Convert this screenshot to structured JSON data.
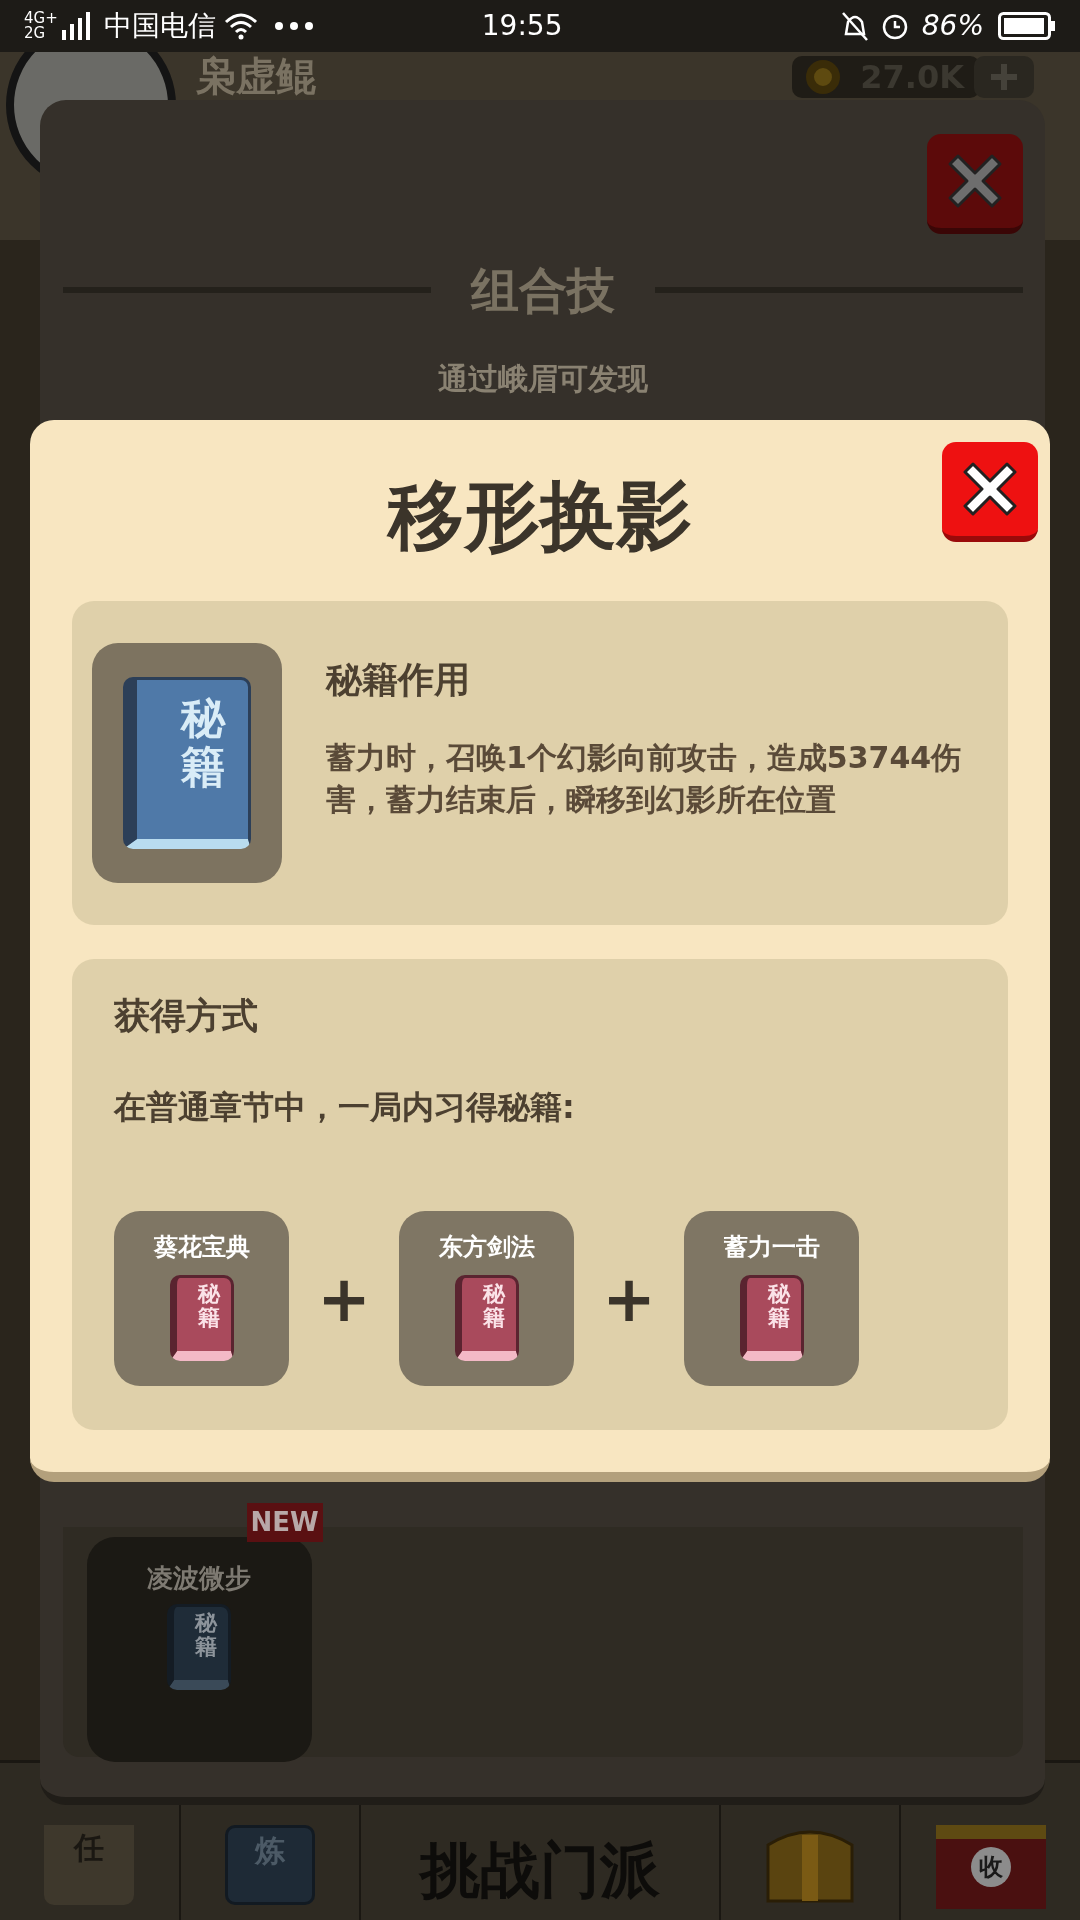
{
  "status_bar": {
    "network_top": "4G+",
    "network_bottom": "2G",
    "carrier": "中国电信",
    "time": "19:55",
    "battery": "86%"
  },
  "background": {
    "player_name": "枭虚鲲",
    "coins": "27.0K",
    "panel": {
      "section_title": "组合技",
      "hint": "通过峨眉可发现",
      "skill": {
        "name": "凌波微步",
        "badge": "NEW",
        "book_label": "秘籍"
      }
    },
    "nav": [
      {
        "kind": "scroll",
        "label": "任"
      },
      {
        "kind": "book",
        "label": "炼"
      },
      {
        "kind": "text",
        "label": "挑战门派"
      },
      {
        "kind": "chest"
      },
      {
        "kind": "shop",
        "label": "收"
      }
    ]
  },
  "dialog": {
    "title": "移形换影",
    "effect": {
      "book_label": "秘籍",
      "heading": "秘籍作用",
      "description": "蓄力时，召唤1个幻影向前攻击，造成53744伤害，蓄力结束后，瞬移到幻影所在位置"
    },
    "obtain": {
      "heading": "获得方式",
      "instruction": "在普通章节中，一局内习得秘籍:",
      "separators": [
        "+",
        "+"
      ],
      "ingredients": [
        {
          "name": "葵花宝典",
          "book_label": "秘籍"
        },
        {
          "name": "东方剑法",
          "book_label": "秘籍"
        },
        {
          "name": "蓄力一击",
          "book_label": "秘籍"
        }
      ]
    }
  }
}
